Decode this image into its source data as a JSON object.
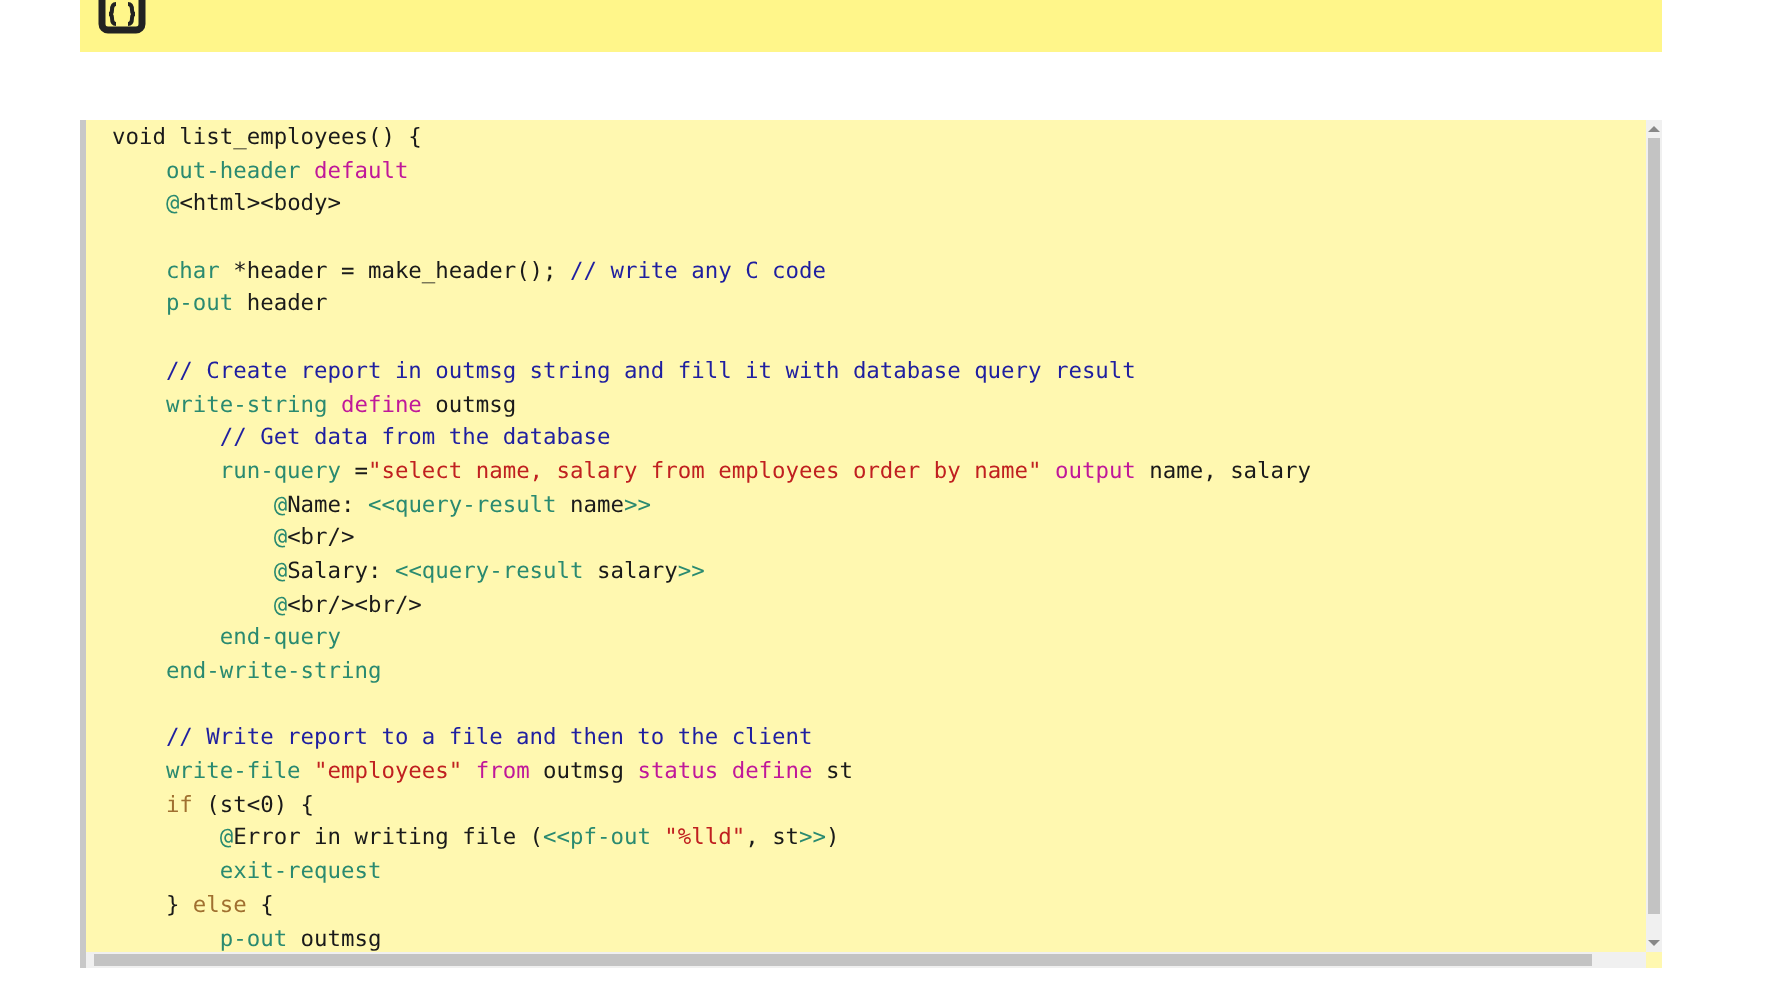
{
  "header": {
    "icon": true
  },
  "code_lines": [
    {
      "kind": "code",
      "tokens": [
        {
          "kind": "plain",
          "text": "void list_employees() {"
        }
      ],
      "children": [
        {
          "kind": "code",
          "tokens": [
            {
              "kind": "statement",
              "text": "out-header"
            },
            {
              "kind": "keyword",
              "text": " default"
            }
          ]
        },
        {
          "kind": "code",
          "tokens": [
            {
              "kind": "statement",
              "text": "@"
            },
            {
              "kind": "plain",
              "text": "<html><body>"
            }
          ]
        },
        {
          "kind": "blank"
        },
        {
          "kind": "code",
          "tokens": [
            {
              "kind": "statement",
              "text": "char"
            },
            {
              "kind": "plain",
              "text": " *header = make_header(); "
            },
            {
              "kind": "comment",
              "text": "// write any C code"
            }
          ]
        },
        {
          "kind": "code",
          "tokens": [
            {
              "kind": "statement",
              "text": "p-out"
            },
            {
              "kind": "plain",
              "text": " header"
            }
          ]
        },
        {
          "kind": "blank"
        },
        {
          "kind": "code",
          "tokens": [
            {
              "kind": "comment",
              "text": "// Create report in outmsg string and fill it with database query result"
            }
          ]
        },
        {
          "kind": "code",
          "tokens": [
            {
              "kind": "statement",
              "text": "write-string"
            },
            {
              "kind": "keyword",
              "text": " define"
            },
            {
              "kind": "plain",
              "text": " outmsg"
            }
          ],
          "children": [
            {
              "kind": "code",
              "tokens": [
                {
                  "kind": "comment",
                  "text": "// Get data from the database"
                }
              ]
            },
            {
              "kind": "code",
              "tokens": [
                {
                  "kind": "statement",
                  "text": "run-query"
                },
                {
                  "kind": "plain",
                  "text": " ="
                },
                {
                  "kind": "string",
                  "text": "\"select name, salary from employees order by name\""
                },
                {
                  "kind": "keyword",
                  "text": " output"
                },
                {
                  "kind": "plain",
                  "text": " name, salary"
                }
              ],
              "children": [
                {
                  "kind": "code",
                  "tokens": [
                    {
                      "kind": "statement",
                      "text": "@"
                    },
                    {
                      "kind": "plain",
                      "text": "Name: "
                    },
                    {
                      "kind": "statement",
                      "text": "<<query-result"
                    },
                    {
                      "kind": "plain",
                      "text": " name"
                    },
                    {
                      "kind": "statement",
                      "text": ">>"
                    }
                  ]
                },
                {
                  "kind": "code",
                  "tokens": [
                    {
                      "kind": "statement",
                      "text": "@"
                    },
                    {
                      "kind": "plain",
                      "text": "<br/>"
                    }
                  ]
                },
                {
                  "kind": "code",
                  "tokens": [
                    {
                      "kind": "statement",
                      "text": "@"
                    },
                    {
                      "kind": "plain",
                      "text": "Salary: "
                    },
                    {
                      "kind": "statement",
                      "text": "<<query-result"
                    },
                    {
                      "kind": "plain",
                      "text": " salary"
                    },
                    {
                      "kind": "statement",
                      "text": ">>"
                    }
                  ]
                },
                {
                  "kind": "code",
                  "tokens": [
                    {
                      "kind": "statement",
                      "text": "@"
                    },
                    {
                      "kind": "plain",
                      "text": "<br/><br/>"
                    }
                  ]
                }
              ]
            },
            {
              "kind": "code",
              "tokens": [
                {
                  "kind": "statement",
                  "text": "end-query"
                }
              ]
            }
          ]
        },
        {
          "kind": "code",
          "tokens": [
            {
              "kind": "statement",
              "text": "end-write-string"
            }
          ]
        },
        {
          "kind": "blank"
        },
        {
          "kind": "code",
          "tokens": [
            {
              "kind": "comment",
              "text": "// Write report to a file and then to the client"
            }
          ]
        },
        {
          "kind": "code",
          "tokens": [
            {
              "kind": "statement",
              "text": "write-file"
            },
            {
              "kind": "string",
              "text": " \"employees\""
            },
            {
              "kind": "keyword",
              "text": " from"
            },
            {
              "kind": "plain",
              "text": " outmsg "
            },
            {
              "kind": "keyword",
              "text": "status define"
            },
            {
              "kind": "plain",
              "text": " st"
            }
          ]
        },
        {
          "kind": "code",
          "tokens": [
            {
              "kind": "control",
              "text": "if"
            },
            {
              "kind": "plain",
              "text": " (st<0) {"
            }
          ],
          "children": [
            {
              "kind": "code",
              "tokens": [
                {
                  "kind": "statement",
                  "text": "@"
                },
                {
                  "kind": "plain",
                  "text": "Error in writing file ("
                },
                {
                  "kind": "statement",
                  "text": "<<pf-out"
                },
                {
                  "kind": "string",
                  "text": " \"%lld\""
                },
                {
                  "kind": "plain",
                  "text": ", st"
                },
                {
                  "kind": "statement",
                  "text": ">>"
                },
                {
                  "kind": "plain",
                  "text": ")"
                }
              ]
            },
            {
              "kind": "code",
              "tokens": [
                {
                  "kind": "statement",
                  "text": "exit-request"
                }
              ]
            }
          ]
        },
        {
          "kind": "code",
          "tokens": [
            {
              "kind": "plain",
              "text": "} "
            },
            {
              "kind": "control",
              "text": "else"
            },
            {
              "kind": "plain",
              "text": " {"
            }
          ],
          "children": [
            {
              "kind": "code",
              "tokens": [
                {
                  "kind": "statement",
                  "text": "p-out"
                },
                {
                  "kind": "plain",
                  "text": " outmsg"
                }
              ]
            }
          ]
        }
      ]
    }
  ]
}
